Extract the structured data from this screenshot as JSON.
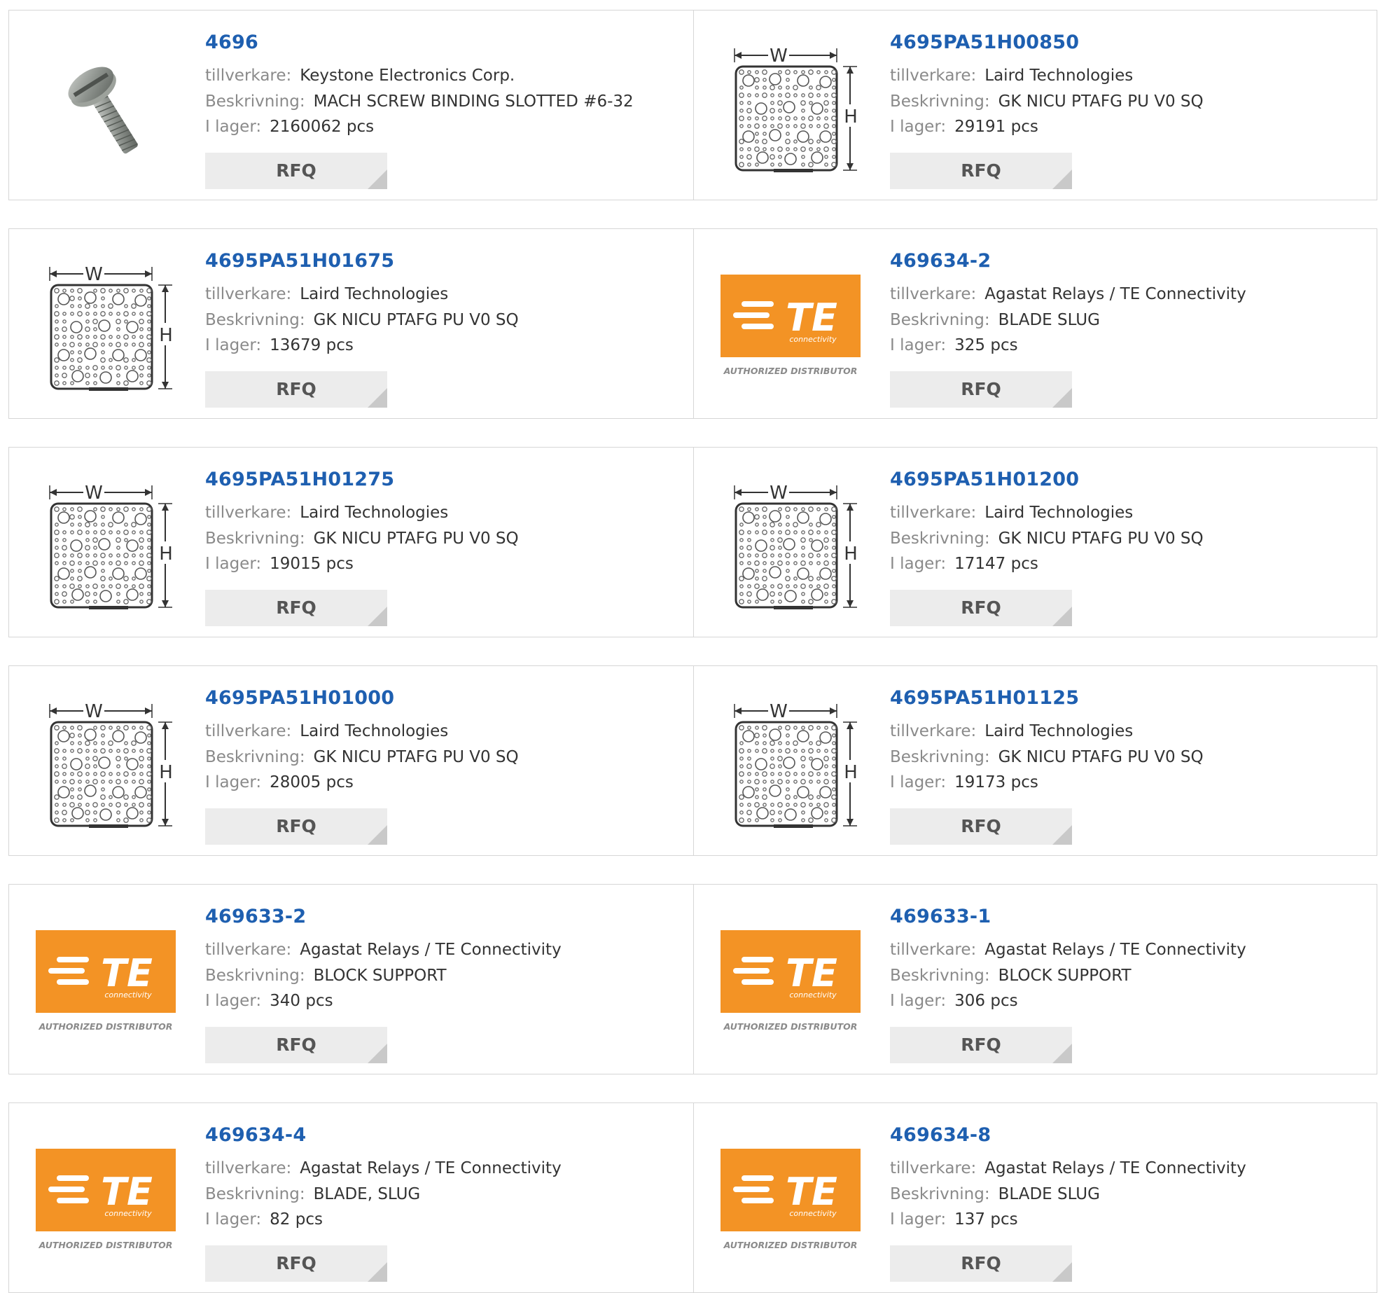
{
  "labels": {
    "manufacturer": "tillverkare:",
    "description": "Beskrivning:",
    "stock": "I lager:",
    "rfq": "RFQ",
    "te_logo_text": "TE",
    "te_logo_sub": "connectivity",
    "te_authorized": "AUTHORIZED DISTRIBUTOR",
    "dim_w": "W",
    "dim_h": "H"
  },
  "colors": {
    "part_link": "#1e5fb0",
    "te_orange": "#f39325",
    "rfq_bg": "#ececec"
  },
  "products": [
    {
      "part": "4696",
      "manufacturer": "Keystone Electronics Corp.",
      "description": "MACH SCREW BINDING SLOTTED #6-32",
      "stock": "2160062 pcs",
      "image": "screw"
    },
    {
      "part": "4695PA51H00850",
      "manufacturer": "Laird Technologies",
      "description": "GK NICU PTAFG PU V0 SQ",
      "stock": "29191 pcs",
      "image": "gasket"
    },
    {
      "part": "4695PA51H01675",
      "manufacturer": "Laird Technologies",
      "description": "GK NICU PTAFG PU V0 SQ",
      "stock": "13679 pcs",
      "image": "gasket"
    },
    {
      "part": "469634-2",
      "manufacturer": "Agastat Relays / TE Connectivity",
      "description": "BLADE SLUG",
      "stock": "325 pcs",
      "image": "te"
    },
    {
      "part": "4695PA51H01275",
      "manufacturer": "Laird Technologies",
      "description": "GK NICU PTAFG PU V0 SQ",
      "stock": "19015 pcs",
      "image": "gasket"
    },
    {
      "part": "4695PA51H01200",
      "manufacturer": "Laird Technologies",
      "description": "GK NICU PTAFG PU V0 SQ",
      "stock": "17147 pcs",
      "image": "gasket"
    },
    {
      "part": "4695PA51H01000",
      "manufacturer": "Laird Technologies",
      "description": "GK NICU PTAFG PU V0 SQ",
      "stock": "28005 pcs",
      "image": "gasket"
    },
    {
      "part": "4695PA51H01125",
      "manufacturer": "Laird Technologies",
      "description": "GK NICU PTAFG PU V0 SQ",
      "stock": "19173 pcs",
      "image": "gasket"
    },
    {
      "part": "469633-2",
      "manufacturer": "Agastat Relays / TE Connectivity",
      "description": "BLOCK SUPPORT",
      "stock": "340 pcs",
      "image": "te"
    },
    {
      "part": "469633-1",
      "manufacturer": "Agastat Relays / TE Connectivity",
      "description": "BLOCK SUPPORT",
      "stock": "306 pcs",
      "image": "te"
    },
    {
      "part": "469634-4",
      "manufacturer": "Agastat Relays / TE Connectivity",
      "description": "BLADE, SLUG",
      "stock": "82 pcs",
      "image": "te"
    },
    {
      "part": "469634-8",
      "manufacturer": "Agastat Relays / TE Connectivity",
      "description": "BLADE SLUG",
      "stock": "137 pcs",
      "image": "te"
    }
  ]
}
